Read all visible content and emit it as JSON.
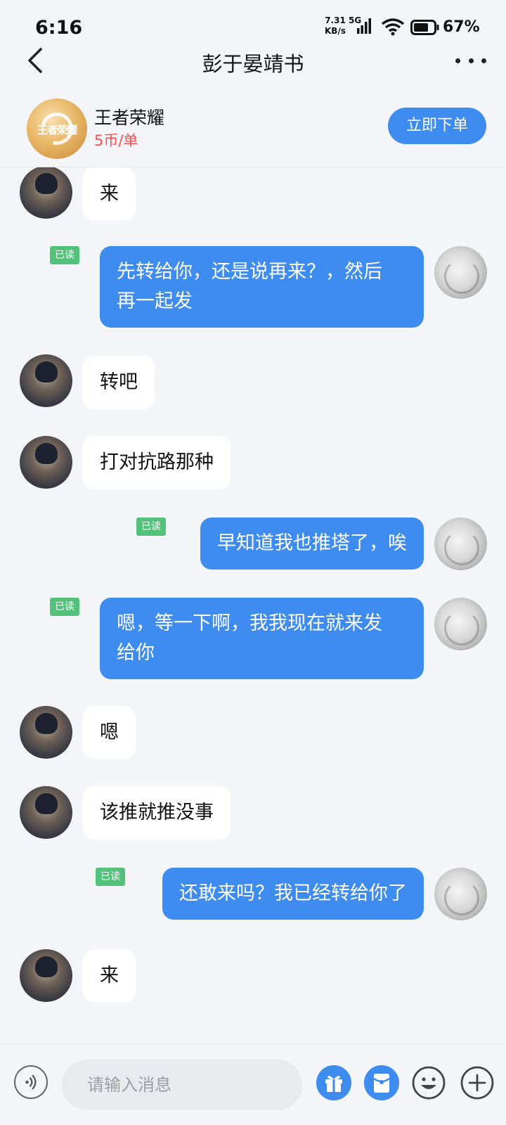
{
  "status_bar": {
    "time": "6:16",
    "net_speed_value": "7.31",
    "net_speed_unit": "KB/s",
    "network_type": "5G",
    "battery": "67%"
  },
  "header": {
    "title": "彭于晏靖书"
  },
  "service": {
    "game_name": "王者荣耀",
    "price": "5币/单",
    "order_button": "立即下单",
    "logo_text": "王者荣耀"
  },
  "messages": [
    {
      "side": "in",
      "text": "来"
    },
    {
      "side": "out",
      "line1": "先转给你，还是说再来？，然后",
      "line2": "再一起发",
      "read": "已读"
    },
    {
      "side": "in",
      "text": "转吧"
    },
    {
      "side": "in",
      "text": "打对抗路那种"
    },
    {
      "side": "out",
      "line1": "早知道我也推塔了，唉",
      "read": "已读"
    },
    {
      "side": "out",
      "line1": "嗯，等一下啊，我我现在就来发",
      "line2": "给你",
      "read": "已读"
    },
    {
      "side": "in",
      "text": "嗯"
    },
    {
      "side": "in",
      "text": "该推就推没事"
    },
    {
      "side": "out",
      "line1": "还敢来吗？我已经转给你了",
      "read": "已读"
    },
    {
      "side": "in",
      "text": "来"
    }
  ],
  "input_bar": {
    "placeholder": "请输入消息",
    "icons": [
      "voice-icon",
      "gift-icon",
      "red-packet-icon",
      "emoji-icon",
      "plus-icon"
    ]
  },
  "colors": {
    "accent": "#3f8cf0",
    "read_badge": "#52c27a",
    "price": "#ff4d4f",
    "background": "#f3f5f8"
  }
}
